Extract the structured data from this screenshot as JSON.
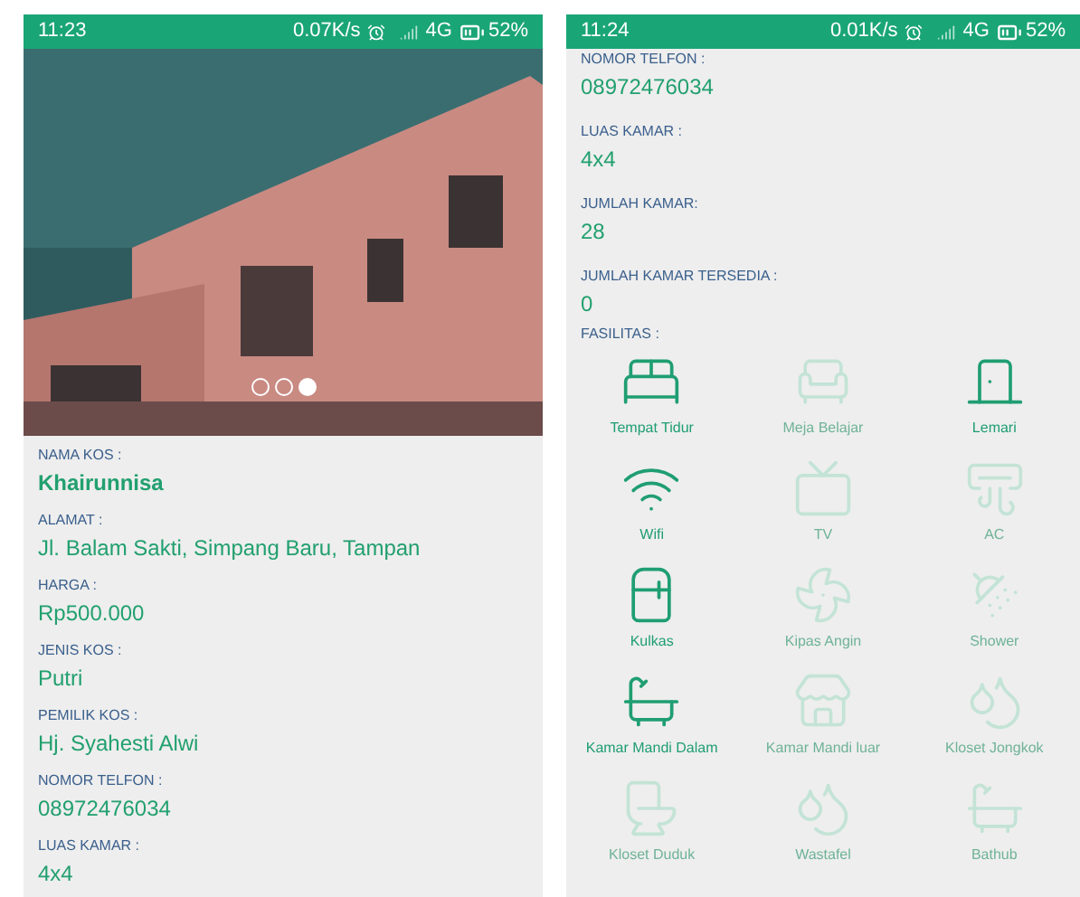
{
  "screens": [
    {
      "status_bar": {
        "time": "11:23",
        "speed": "0.07K/s",
        "network": "4G",
        "battery": "52%"
      },
      "gallery": {
        "dots": [
          {
            "selected": false
          },
          {
            "selected": false
          },
          {
            "selected": true
          }
        ]
      },
      "fields": [
        {
          "label": "NAMA KOS :",
          "value": "Khairunnisa",
          "kind": "title"
        },
        {
          "label": "ALAMAT :",
          "value": "Jl. Balam Sakti, Simpang Baru, Tampan",
          "kind": "text"
        },
        {
          "label": "HARGA :",
          "value": "Rp500.000",
          "kind": "text"
        },
        {
          "label": "JENIS KOS :",
          "value": "Putri",
          "kind": "text"
        },
        {
          "label": "PEMILIK KOS :",
          "value": "Hj. Syahesti Alwi",
          "kind": "text"
        },
        {
          "label": "NOMOR TELFON :",
          "value": "08972476034",
          "kind": "text"
        },
        {
          "label": "LUAS KAMAR :",
          "value": "4x4",
          "kind": "text"
        }
      ]
    },
    {
      "status_bar": {
        "time": "11:24",
        "speed": "0.01K/s",
        "network": "4G",
        "battery": "52%"
      },
      "fields": [
        {
          "label": "NOMOR TELFON :",
          "value": "08972476034",
          "kind": "text"
        },
        {
          "label": "LUAS KAMAR :",
          "value": "4x4",
          "kind": "text"
        },
        {
          "label": "JUMLAH KAMAR:",
          "value": "28",
          "kind": "text"
        },
        {
          "label": "JUMLAH KAMAR TERSEDIA :",
          "value": "0",
          "kind": "text"
        }
      ],
      "facilities_label": "FASILITAS :",
      "facilities": [
        {
          "kind": "bed",
          "label": "Tempat Tidur",
          "available": true
        },
        {
          "kind": "desk",
          "label": "Meja Belajar",
          "available": false
        },
        {
          "kind": "wardrobe",
          "label": "Lemari",
          "available": true
        },
        {
          "kind": "wifi",
          "label": "Wifi",
          "available": true
        },
        {
          "kind": "tv",
          "label": "TV",
          "available": false
        },
        {
          "kind": "ac",
          "label": "AC",
          "available": false
        },
        {
          "kind": "fridge",
          "label": "Kulkas",
          "available": true
        },
        {
          "kind": "fan",
          "label": "Kipas Angin",
          "available": false
        },
        {
          "kind": "shower",
          "label": "Shower",
          "available": false
        },
        {
          "kind": "bath_in",
          "label": "Kamar Mandi Dalam",
          "available": true
        },
        {
          "kind": "bath_out",
          "label": "Kamar Mandi luar",
          "available": false
        },
        {
          "kind": "squat_toilet",
          "label": "Kloset Jongkok",
          "available": false
        },
        {
          "kind": "toilet",
          "label": "Kloset Duduk",
          "available": false
        },
        {
          "kind": "sink",
          "label": "Wastafel",
          "available": false
        },
        {
          "kind": "bathtub",
          "label": "Bathub",
          "available": false
        }
      ]
    }
  ]
}
